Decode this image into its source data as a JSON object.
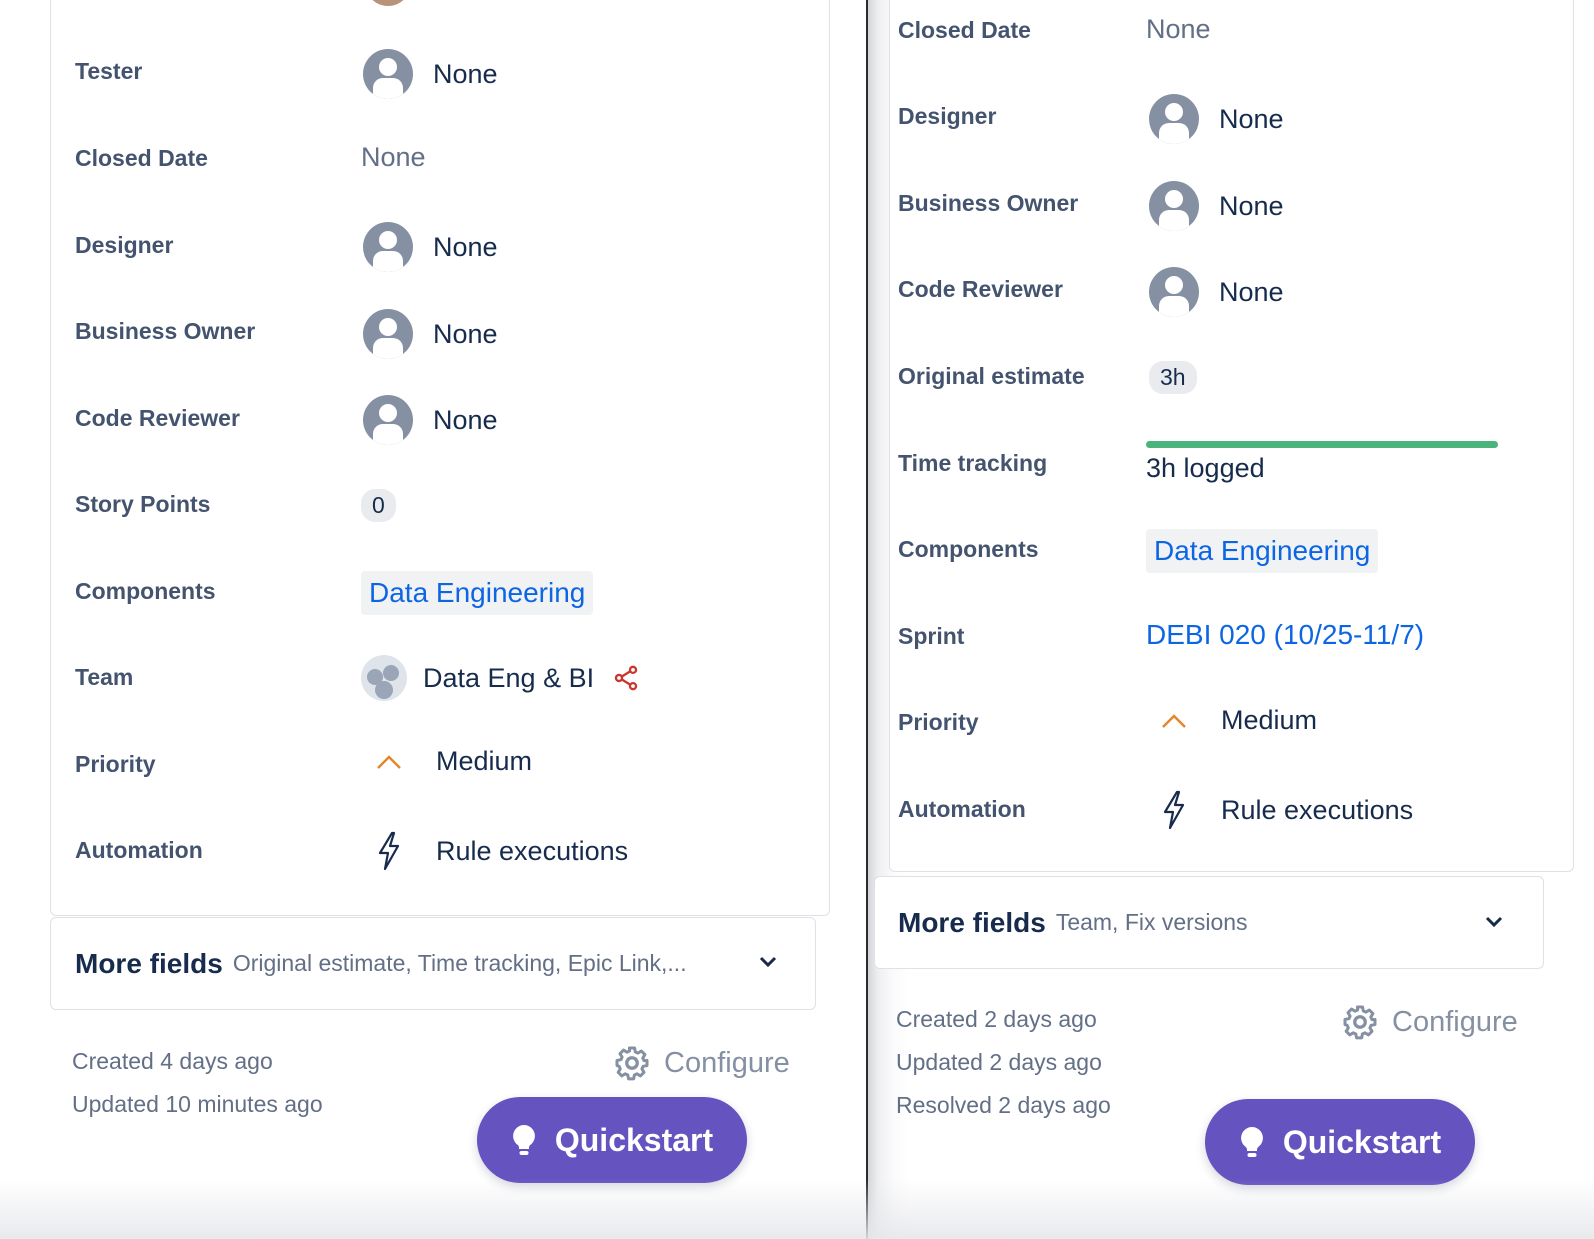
{
  "left": {
    "fields": {
      "tester": {
        "label": "Tester",
        "value": "None"
      },
      "closed_date": {
        "label": "Closed Date",
        "value": "None"
      },
      "designer": {
        "label": "Designer",
        "value": "None"
      },
      "business_owner": {
        "label": "Business Owner",
        "value": "None"
      },
      "code_reviewer": {
        "label": "Code Reviewer",
        "value": "None"
      },
      "story_points": {
        "label": "Story Points",
        "value": "0"
      },
      "components": {
        "label": "Components",
        "value": "Data Engineering"
      },
      "team": {
        "label": "Team",
        "value": "Data Eng & BI"
      },
      "priority": {
        "label": "Priority",
        "value": "Medium"
      },
      "automation": {
        "label": "Automation",
        "value": "Rule executions"
      }
    },
    "more_fields": {
      "title": "More fields",
      "subtitle": "Original estimate, Time tracking, Epic Link,..."
    },
    "meta": {
      "created": "Created 4 days ago",
      "updated": "Updated 10 minutes ago"
    },
    "configure_label": "Configure",
    "quickstart_label": "Quickstart"
  },
  "right": {
    "fields": {
      "closed_date": {
        "label": "Closed Date",
        "value": "None"
      },
      "designer": {
        "label": "Designer",
        "value": "None"
      },
      "business_owner": {
        "label": "Business Owner",
        "value": "None"
      },
      "code_reviewer": {
        "label": "Code Reviewer",
        "value": "None"
      },
      "original_estimate": {
        "label": "Original estimate",
        "value": "3h"
      },
      "time_tracking": {
        "label": "Time tracking",
        "value": "3h logged",
        "progress": 1.0
      },
      "components": {
        "label": "Components",
        "value": "Data Engineering"
      },
      "sprint": {
        "label": "Sprint",
        "value": "DEBI 020 (10/25-11/7)"
      },
      "priority": {
        "label": "Priority",
        "value": "Medium"
      },
      "automation": {
        "label": "Automation",
        "value": "Rule executions"
      }
    },
    "more_fields": {
      "title": "More fields",
      "subtitle": "Team, Fix versions"
    },
    "meta": {
      "created": "Created 2 days ago",
      "updated": "Updated 2 days ago",
      "resolved": "Resolved 2 days ago"
    },
    "configure_label": "Configure",
    "quickstart_label": "Quickstart"
  },
  "colors": {
    "accent_link": "#0c66e4",
    "quickstart_bg": "#6553c0",
    "progress_green": "#4bb37c",
    "priority_medium": "#e2862b",
    "share_icon": "#c9372c"
  },
  "icons": [
    "user-avatar-icon",
    "team-avatar-icon",
    "share-icon",
    "priority-medium-icon",
    "lightning-bolt-icon",
    "chevron-down-icon",
    "gear-icon",
    "lightbulb-icon"
  ]
}
